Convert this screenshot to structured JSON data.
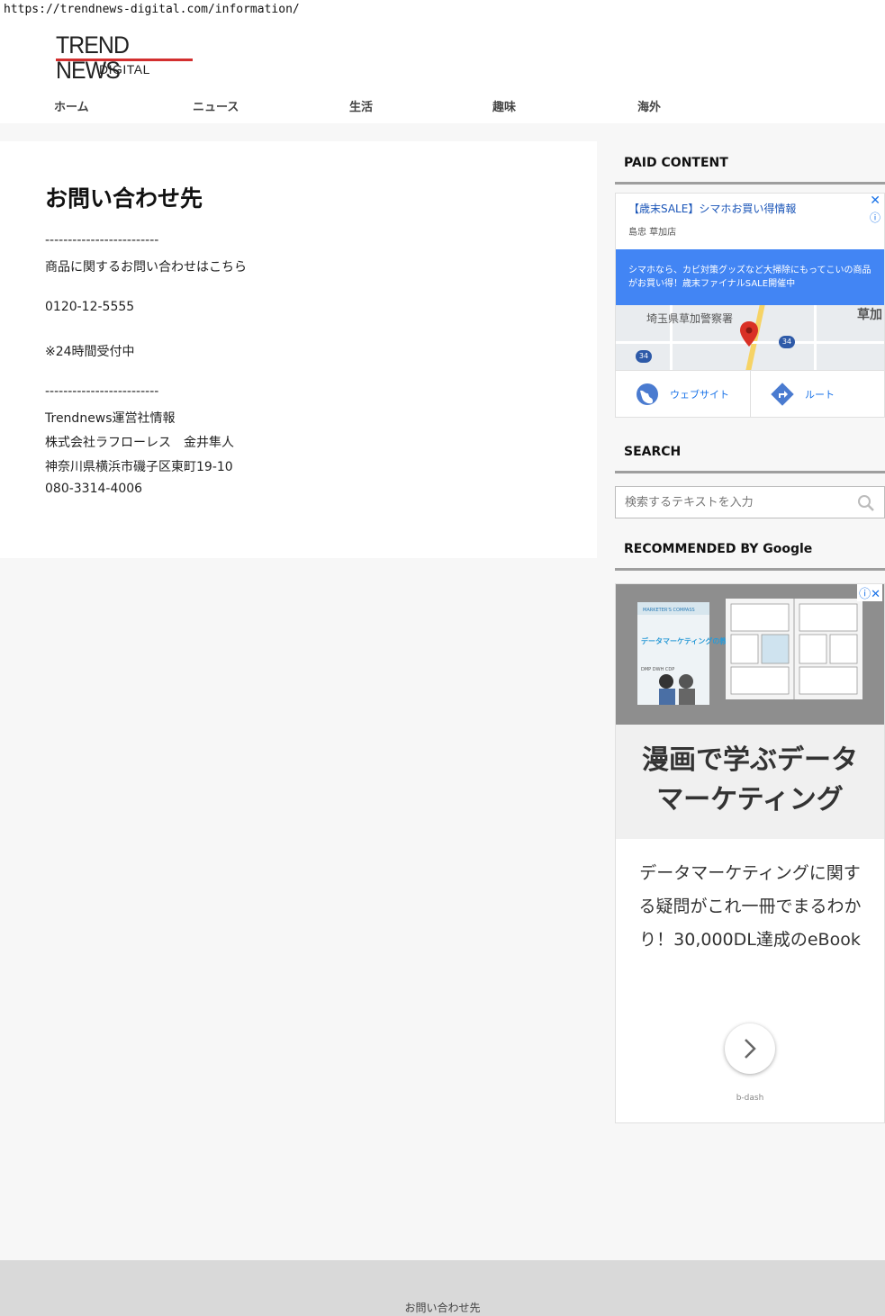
{
  "browser": {
    "url": "https://trendnews-digital.com/information/"
  },
  "site": {
    "logo_main": "TREND NEWS",
    "logo_sub": "DIGITAL"
  },
  "nav": {
    "items": [
      "ホーム",
      "ニュース",
      "生活",
      "趣味",
      "海外"
    ]
  },
  "page": {
    "title": "お問い合わせ先",
    "lines": [
      "-------------------------",
      "商品に関するお問い合わせはこちら",
      "0120-12-5555",
      "※24時間受付中",
      "-------------------------",
      "Trendnews運営社情報",
      "株式会社ラフローレス　金井隼人",
      "神奈川県横浜市磯子区東町19-10",
      "080-3314-4006"
    ]
  },
  "sidebar": {
    "paid_title": "PAID CONTENT",
    "search_title": "SEARCH",
    "search_placeholder": "検索するテキストを入力",
    "recommended_title": "RECOMMENDED BY Google"
  },
  "ad_map": {
    "title": "【歳末SALE】シマホお買い得情報",
    "subtitle": "島忠 草加店",
    "banner": "シマホなら、カビ対策グッズなど大掃除にもってこいの商品がお買い得！歳末ファイナルSALE開催中",
    "place": "埼玉県草加警察署",
    "place2": "草加",
    "route_num": "34",
    "website_label": "ウェブサイト",
    "route_label": "ルート",
    "accent_color": "#4285f4"
  },
  "ad_book": {
    "headline_1": "漫画で学ぶデータ",
    "headline_2": "マーケティング",
    "description": "データマーケティングに関する疑問がこれ一冊でまるわかり！30,000DL達成のeBook",
    "brand": "b-dash",
    "book_cover_title": "データマーケティングの教科書",
    "book_series": "MARKETER'S COMPASS",
    "book_tags": "DMP DWH CDP"
  },
  "footer": {
    "link": "お問い合わせ先"
  }
}
